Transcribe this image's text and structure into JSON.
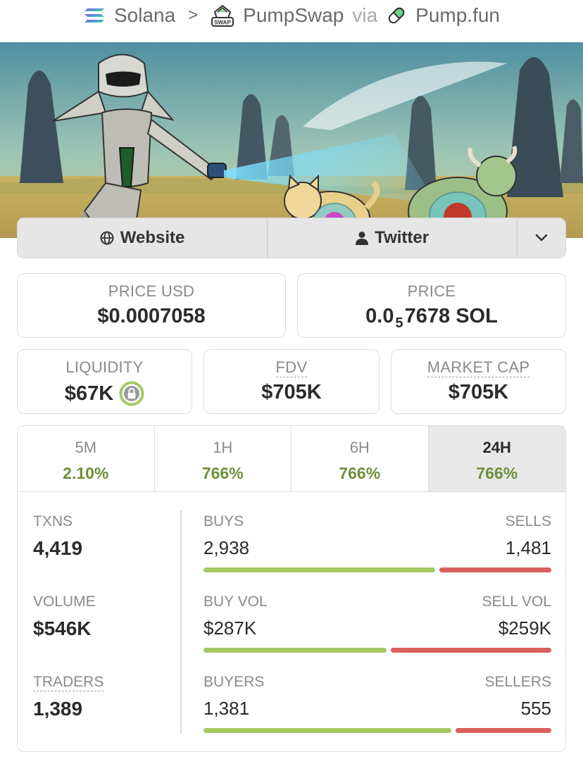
{
  "breadcrumb": {
    "chain": "Solana",
    "separator": ">",
    "dex": "PumpSwap",
    "dex_icon_text": "SWAP",
    "via": "via",
    "launchpad": "Pump.fun"
  },
  "links": {
    "website": "Website",
    "twitter": "Twitter"
  },
  "stats": {
    "price_usd": {
      "label": "PRICE USD",
      "value": "$0.0007058"
    },
    "price_native": {
      "label": "PRICE",
      "prefix": "0.0",
      "subscript": "5",
      "rest": "7678 SOL"
    },
    "liquidity": {
      "label": "LIQUIDITY",
      "value": "$67K"
    },
    "fdv": {
      "label": "FDV",
      "value": "$705K"
    },
    "market_cap": {
      "label": "MARKET CAP",
      "value": "$705K"
    }
  },
  "timeframes": [
    {
      "label": "5M",
      "change": "2.10%",
      "active": false
    },
    {
      "label": "1H",
      "change": "766%",
      "active": false
    },
    {
      "label": "6H",
      "change": "766%",
      "active": false
    },
    {
      "label": "24H",
      "change": "766%",
      "active": true
    }
  ],
  "left": {
    "txns": {
      "label": "TXNS",
      "value": "4,419"
    },
    "volume": {
      "label": "VOLUME",
      "value": "$546K"
    },
    "traders": {
      "label": "TRADERS",
      "value": "1,389"
    }
  },
  "rows": {
    "txns": {
      "left_label": "BUYS",
      "right_label": "SELLS",
      "left_value": "2,938",
      "right_value": "1,481",
      "buy_fraction": 0.665
    },
    "volume": {
      "left_label": "BUY VOL",
      "right_label": "SELL VOL",
      "left_value": "$287K",
      "right_value": "$259K",
      "buy_fraction": 0.526
    },
    "traders": {
      "left_label": "BUYERS",
      "right_label": "SELLERS",
      "left_value": "1,381",
      "right_value": "555",
      "buy_fraction": 0.713
    }
  },
  "colors": {
    "positive": "#6e8f3a",
    "buy_bar": "#a6c863",
    "sell_bar": "#d9605c",
    "lock_ring": "#a6c863"
  }
}
